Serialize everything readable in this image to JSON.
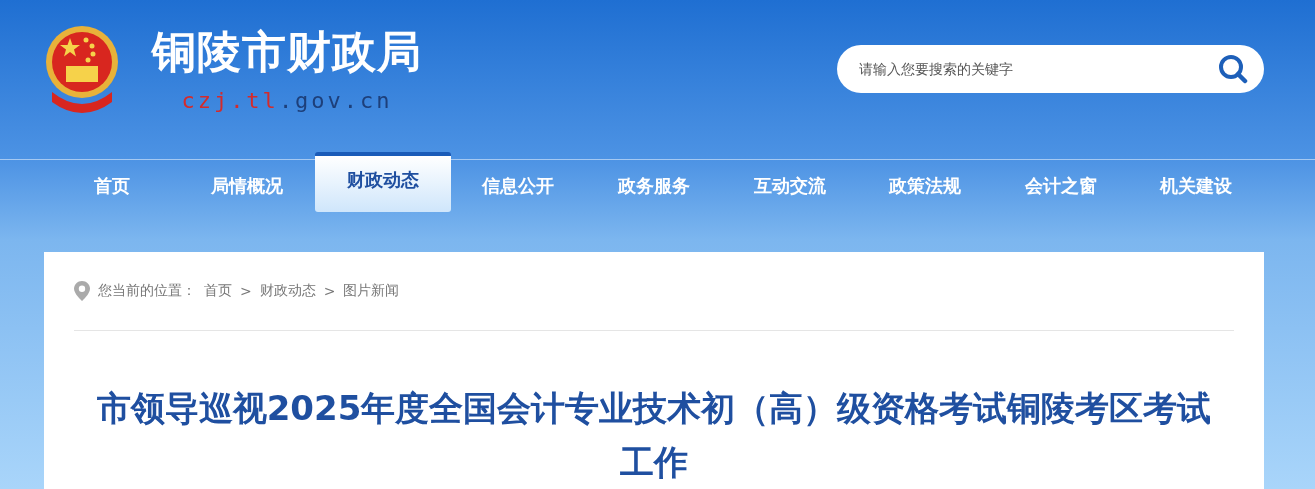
{
  "site": {
    "name": "铜陵市财政局",
    "domain": [
      {
        "text": "czj.tl",
        "color": "#d42b2b"
      },
      {
        "text": ".gov.cn",
        "color": "#1d3f7a"
      }
    ]
  },
  "search": {
    "placeholder": "请输入您要搜索的关键字"
  },
  "nav": [
    {
      "label": "首页",
      "selected": false
    },
    {
      "label": "局情概况",
      "selected": false
    },
    {
      "label": "财政动态",
      "selected": true
    },
    {
      "label": "信息公开",
      "selected": false
    },
    {
      "label": "政务服务",
      "selected": false
    },
    {
      "label": "互动交流",
      "selected": false
    },
    {
      "label": "政策法规",
      "selected": false
    },
    {
      "label": "会计之窗",
      "selected": false
    },
    {
      "label": "机关建设",
      "selected": false
    }
  ],
  "breadcrumb": {
    "label": "您当前的位置：",
    "items": [
      "首页",
      "财政动态",
      "图片新闻"
    ],
    "separator": ">"
  },
  "article": {
    "title": "市领导巡视2025年度全国会计专业技术初（高）级资格考试铜陵考区考试工作"
  }
}
